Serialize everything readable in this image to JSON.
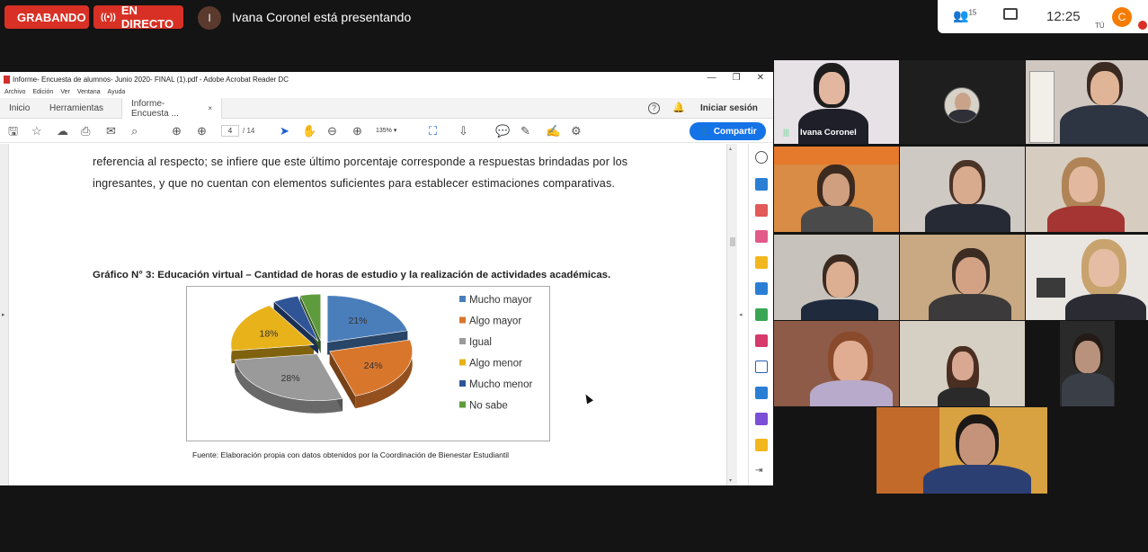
{
  "meet": {
    "recording_label": "GRABANDO",
    "live_label": "EN DIRECTO",
    "presenter_initial": "I",
    "presenter_text": "Ivana Coronel está presentando",
    "participants_count": "15",
    "time": "12:25",
    "user_initial": "C",
    "user_label": "TÚ"
  },
  "acrobat": {
    "window_title": "Informe- Encuesta de alumnos- Junio 2020- FINAL (1).pdf - Adobe Acrobat Reader DC",
    "menu": [
      "Archivo",
      "Edición",
      "Ver",
      "Ventana",
      "Ayuda"
    ],
    "tabs": {
      "home": "Inicio",
      "tools": "Herramientas",
      "doc": "Informe- Encuesta ...",
      "close": "×"
    },
    "login_label": "Iniciar sesión",
    "page_current": "4",
    "page_total": "/ 14",
    "zoom": "135%",
    "share_label": "Compartir"
  },
  "document": {
    "line1": "referencia al respecto; se infiere que este último porcentaje corresponde a respuestas brindadas por los",
    "line2": "ingresantes, y que no cuentan con elementos suficientes para establecer estimaciones comparativas.",
    "figure_caption": "Gráfico N° 3: Educación virtual – Cantidad de horas de estudio y la realización de actividades académicas.",
    "source": "Fuente: Elaboración propia con datos obtenidos por la Coordinación de Bienestar Estudiantil"
  },
  "chart_data": {
    "type": "pie",
    "title": "",
    "categories": [
      "Mucho mayor",
      "Algo mayor",
      "Igual",
      "Algo menor",
      "Mucho menor",
      "No sabe"
    ],
    "values": [
      21,
      24,
      28,
      18,
      5,
      4
    ],
    "labels": [
      "21%",
      "24%",
      "28%",
      "18%",
      "5%",
      "4%"
    ],
    "colors": [
      "#4a7ebb",
      "#d8762c",
      "#9a9a9a",
      "#e8b21a",
      "#2f5597",
      "#5e9b3c"
    ],
    "exploded": true,
    "style": "3d",
    "legend_position": "right"
  },
  "participants": [
    {
      "name": "Ivana Coronel",
      "mic_on": true
    },
    {
      "name": ""
    },
    {
      "name": ""
    },
    {
      "name": ""
    },
    {
      "name": ""
    },
    {
      "name": ""
    },
    {
      "name": ""
    },
    {
      "name": ""
    },
    {
      "name": ""
    },
    {
      "name": ""
    },
    {
      "name": ""
    },
    {
      "name": ""
    },
    {
      "name": ""
    }
  ]
}
